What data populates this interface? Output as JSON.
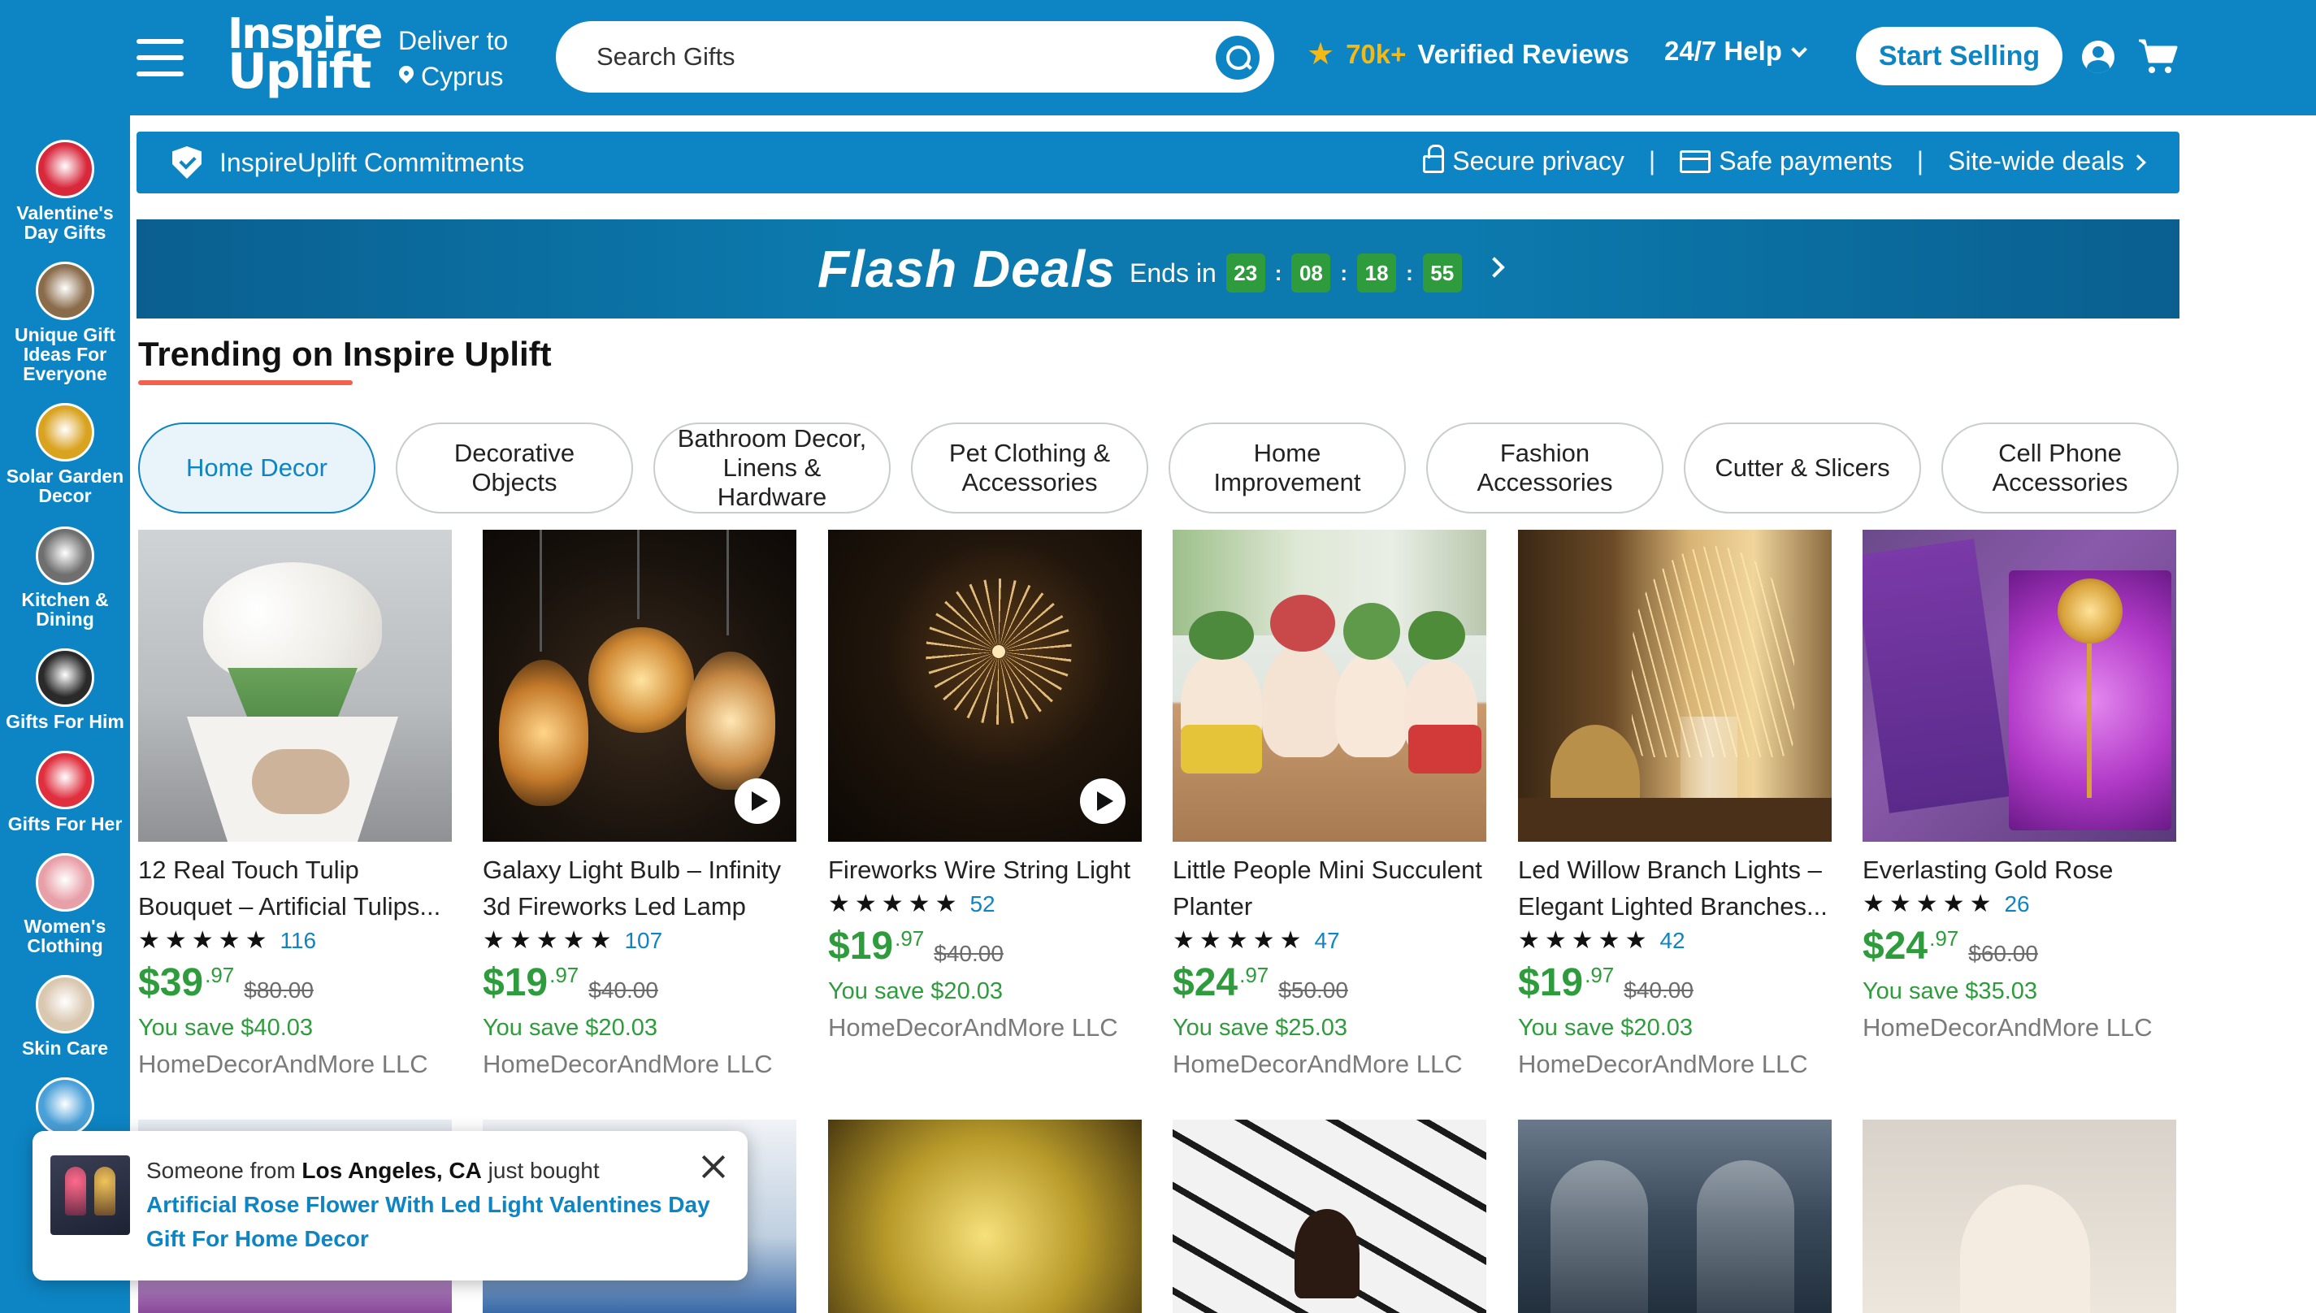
{
  "header": {
    "logo_line1": "Inspire",
    "logo_line2": "Uplift",
    "deliver_label": "Deliver to",
    "deliver_location": "Cyprus",
    "search_placeholder": "Search Gifts",
    "reviews_count": "70k+",
    "reviews_label": "Verified Reviews",
    "help_label": "24/7 Help",
    "start_selling": "Start Selling"
  },
  "sidebar": {
    "items": [
      {
        "label": "Valentine's Day Gifts",
        "color": "#d8283c"
      },
      {
        "label": "Unique Gift Ideas For Everyone",
        "color": "#8a6b4a"
      },
      {
        "label": "Solar Garden Decor",
        "color": "#d9a21f"
      },
      {
        "label": "Kitchen & Dining",
        "color": "#6f6f6f"
      },
      {
        "label": "Gifts For Him",
        "color": "#2a2a2a"
      },
      {
        "label": "Gifts For Her",
        "color": "#e0303f"
      },
      {
        "label": "Women's Clothing",
        "color": "#e8a0a8"
      },
      {
        "label": "Skin Care",
        "color": "#d9c7b0"
      },
      {
        "label": "",
        "color": "#4aa0d8"
      }
    ]
  },
  "commitments": {
    "title": "InspireUplift Commitments",
    "secure_privacy": "Secure privacy",
    "safe_payments": "Safe payments",
    "site_deals": "Site-wide deals",
    "separator": "|"
  },
  "flash": {
    "title": "Flash Deals",
    "ends_label": "Ends in",
    "hours": "23",
    "minutes": "08",
    "seconds": "18",
    "frames": "55",
    "colon": ":"
  },
  "trending": {
    "title": "Trending on Inspire Uplift",
    "tabs": [
      "Home Decor",
      "Decorative Objects",
      "Bathroom Decor, Linens & Hardware",
      "Pet Clothing & Accessories",
      "Home Improvement",
      "Fashion Accessories",
      "Cutter & Slicers",
      "Cell Phone Accessories"
    ]
  },
  "products": [
    {
      "name": "12 Real Touch Tulip Bouquet – Artificial Tulips...",
      "stars": "★★★★★",
      "reviews": "116",
      "price": "$39",
      "cents": ".97",
      "old": "$80.00",
      "save": "You save $40.03",
      "seller": "HomeDecorAndMore LLC"
    },
    {
      "name": "Galaxy Light Bulb – Infinity 3d Fireworks Led Lamp",
      "stars": "★★★★★",
      "reviews": "107",
      "price": "$19",
      "cents": ".97",
      "old": "$40.00",
      "save": "You save $20.03",
      "seller": "HomeDecorAndMore LLC"
    },
    {
      "name": "Fireworks Wire String Light",
      "stars": "★★★★★",
      "reviews": "52",
      "price": "$19",
      "cents": ".97",
      "old": "$40.00",
      "save": "You save $20.03",
      "seller": "HomeDecorAndMore LLC"
    },
    {
      "name": "Little People Mini Succulent Planter",
      "stars": "★★★★★",
      "reviews": "47",
      "price": "$24",
      "cents": ".97",
      "old": "$50.00",
      "save": "You save $25.03",
      "seller": "HomeDecorAndMore LLC"
    },
    {
      "name": "Led Willow Branch Lights – Elegant Lighted Branches...",
      "stars": "★★★★★",
      "reviews": "42",
      "price": "$19",
      "cents": ".97",
      "old": "$40.00",
      "save": "You save $20.03",
      "seller": "HomeDecorAndMore LLC"
    },
    {
      "name": "Everlasting Gold Rose",
      "stars": "★★★★★",
      "reviews": "26",
      "price": "$24",
      "cents": ".97",
      "old": "$60.00",
      "save": "You save $35.03",
      "seller": "HomeDecorAndMore LLC"
    }
  ],
  "popup": {
    "prefix": "Someone from",
    "location": "Los Angeles, CA",
    "suffix": "just bought",
    "product": "Artificial Rose Flower With Led Light Valentines Day Gift For Home Decor"
  },
  "colors": {
    "brand_blue": "#0d85c4",
    "price_green": "#2e9c3c",
    "star_gold": "#f5b916",
    "accent_red": "#f2614e"
  }
}
